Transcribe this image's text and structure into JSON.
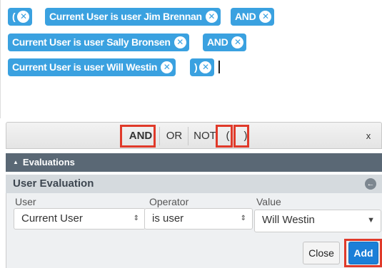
{
  "formula": {
    "tokens": [
      {
        "label": "("
      },
      {
        "label": "Current User is user Jim Brennan"
      },
      {
        "label": "AND"
      },
      {
        "label": "Current User is user Sally Bronsen"
      },
      {
        "label": "AND"
      },
      {
        "label": "Current User is user Will Westin"
      },
      {
        "label": ")"
      }
    ],
    "remove_glyph": "✕"
  },
  "toolbar": {
    "and_label": "AND",
    "or_label": "OR",
    "not_label": "NOT",
    "open_paren_label": "(",
    "close_paren_label": ")",
    "close_label": "x"
  },
  "evaluations": {
    "header": "Evaluations",
    "section_title": "User Evaluation",
    "fields": {
      "user_label": "User",
      "user_value": "Current User",
      "operator_label": "Operator",
      "operator_value": "is user",
      "value_label": "Value",
      "value_value": "Will Westin"
    },
    "close_button": "Close",
    "add_button": "Add"
  },
  "colors": {
    "token": "#3aa1e0",
    "highlight": "#e03a2a",
    "add": "#1b7fd8"
  }
}
